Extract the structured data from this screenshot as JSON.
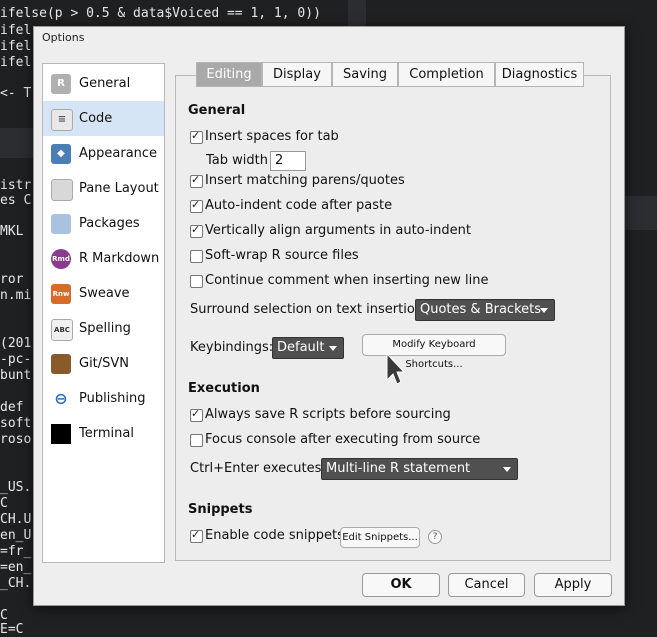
{
  "background": {
    "code_lines": [
      {
        "text": "ifelse(p > 0.5 & data$Voiced == 1, 1, 0))"
      },
      {
        "text": "ifel"
      },
      {
        "text": "ifel"
      },
      {
        "text": "ifel"
      },
      {
        "text": "<- T"
      },
      {
        "text": "istr"
      },
      {
        "text": "es C"
      },
      {
        "text": "MKL"
      },
      {
        "text": "ror"
      },
      {
        "text": "n.mi"
      },
      {
        "text": "(201"
      },
      {
        "text": "-pc-"
      },
      {
        "text": "bunt"
      },
      {
        "text": "def"
      },
      {
        "text": "soft"
      },
      {
        "text": "roso"
      },
      {
        "text": "_US."
      },
      {
        "text": "C"
      },
      {
        "text": "CH.U"
      },
      {
        "text": "en_U"
      },
      {
        "text": "=fr_"
      },
      {
        "text": "=en_"
      },
      {
        "text": "_CH."
      },
      {
        "text": "C"
      },
      {
        "text": "E=C"
      }
    ]
  },
  "dialog": {
    "title": "Options",
    "sidebar": [
      {
        "label": "General",
        "icon": "r-logo-icon",
        "color": "#b0b0b0"
      },
      {
        "label": "Code",
        "icon": "code-file-icon",
        "color": "#d0d0d0",
        "selected": true
      },
      {
        "label": "Appearance",
        "icon": "paint-bucket-icon",
        "color": "#4a7fb5"
      },
      {
        "label": "Pane Layout",
        "icon": "pane-layout-icon",
        "color": "#c8c8c8"
      },
      {
        "label": "Packages",
        "icon": "packages-icon",
        "color": "#a9c2e0"
      },
      {
        "label": "R Markdown",
        "icon": "rmd-icon",
        "color": "#8a3b8f"
      },
      {
        "label": "Sweave",
        "icon": "sweave-icon",
        "color": "#d86b2a"
      },
      {
        "label": "Spelling",
        "icon": "spelling-icon",
        "color": "#7aa05a"
      },
      {
        "label": "Git/SVN",
        "icon": "git-box-icon",
        "color": "#8a5a2a"
      },
      {
        "label": "Publishing",
        "icon": "publishing-icon",
        "color": "#2a6fc4"
      },
      {
        "label": "Terminal",
        "icon": "terminal-icon",
        "color": "#000000"
      }
    ],
    "tabs": [
      "Editing",
      "Display",
      "Saving",
      "Completion",
      "Diagnostics"
    ],
    "general_heading": "General",
    "insert_spaces": "Insert spaces for tab",
    "tab_width_label": "Tab width",
    "tab_width_value": "2",
    "insert_matching": "Insert matching parens/quotes",
    "auto_indent": "Auto-indent code after paste",
    "vertical_align": "Vertically align arguments in auto-indent",
    "soft_wrap": "Soft-wrap R source files",
    "continue_comment": "Continue comment when inserting new line",
    "surround_label": "Surround selection on text insertion:",
    "surround_value": "Quotes & Brackets",
    "keybindings_label": "Keybindings:",
    "keybindings_value": "Default",
    "modify_shortcuts": "Modify Keyboard Shortcuts...",
    "execution_heading": "Execution",
    "always_save": "Always save R scripts before sourcing",
    "focus_console": "Focus console after executing from source",
    "ctrl_enter_label": "Ctrl+Enter executes:",
    "ctrl_enter_value": "Multi-line R statement",
    "snippets_heading": "Snippets",
    "enable_snippets": "Enable code snippets",
    "edit_snippets": "Edit Snippets...",
    "help": "?",
    "ok": "OK",
    "cancel": "Cancel",
    "apply": "Apply"
  }
}
